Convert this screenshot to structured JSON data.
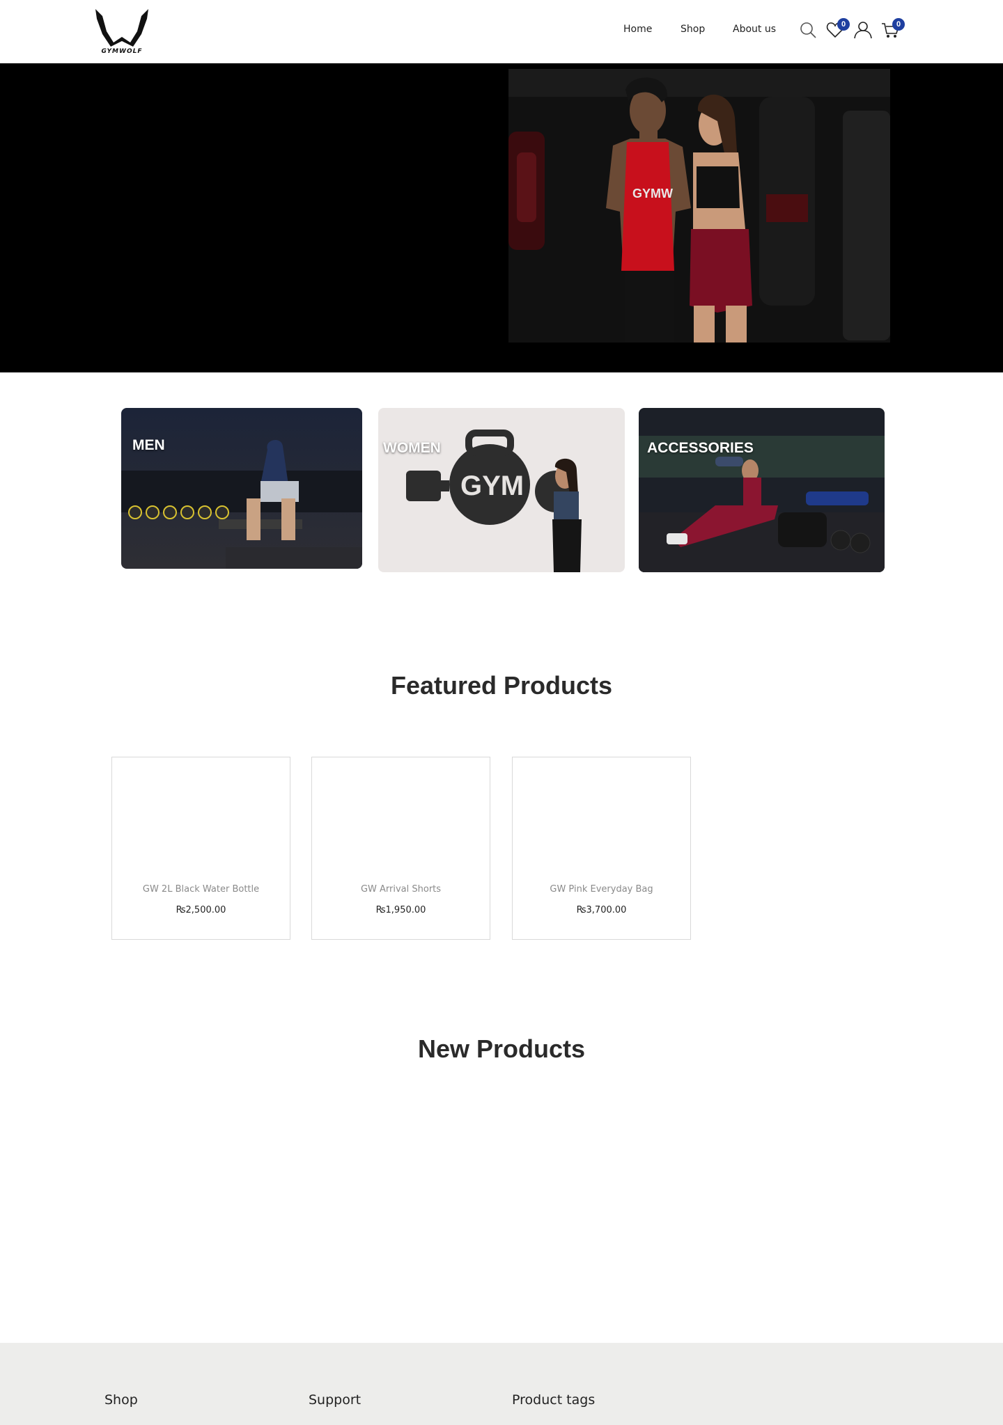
{
  "brand": {
    "name": "GYMWOLF"
  },
  "nav": {
    "home": "Home",
    "shop": "Shop",
    "about": "About us"
  },
  "header_icons": {
    "search": "search-icon",
    "wishlist": "heart-icon",
    "account": "user-icon",
    "cart": "cart-icon"
  },
  "badges": {
    "wishlist_count": "0",
    "cart_count": "0"
  },
  "categories": [
    {
      "label": "MEN"
    },
    {
      "label": "WOMEN"
    },
    {
      "label": "ACCESSORIES"
    }
  ],
  "featured": {
    "title": "Featured Products",
    "products": [
      {
        "name": "GW 2L Black Water Bottle",
        "price": "₨2,500.00"
      },
      {
        "name": "GW Arrival Shorts",
        "price": "₨1,950.00"
      },
      {
        "name": "GW Pink Everyday Bag",
        "price": "₨3,700.00"
      }
    ]
  },
  "new_products": {
    "title": "New Products"
  },
  "footer": {
    "col1": "Shop",
    "col2": "Support",
    "col3": "Product tags"
  },
  "colors": {
    "badge": "#1e3fa0",
    "footer_bg": "#ededeb",
    "hero_bg": "#000000"
  }
}
